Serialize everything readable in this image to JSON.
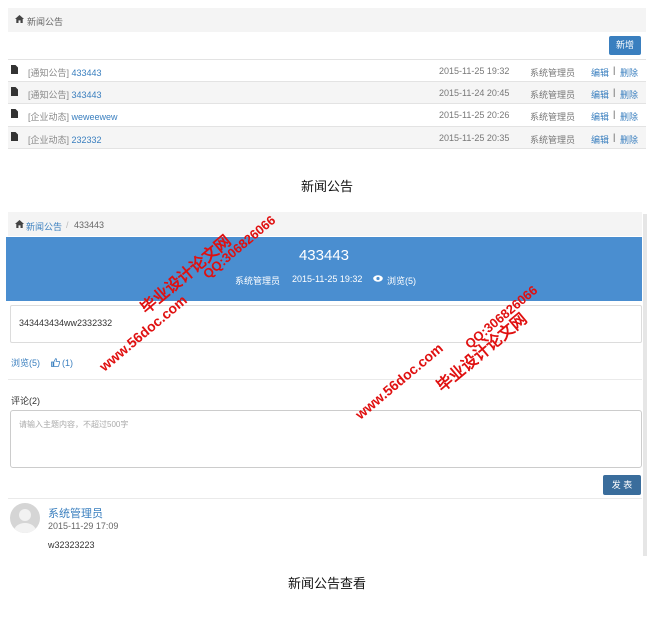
{
  "list_page": {
    "breadcrumb": "新闻公告",
    "add_button": "新增",
    "rows": [
      {
        "category": "[通知公告]",
        "title": "433443",
        "date": "2015-11-25 19:32",
        "author": "系统管理员",
        "edit": "编辑",
        "sep": "|",
        "delete": "删除"
      },
      {
        "category": "[通知公告]",
        "title": "343443",
        "date": "2015-11-24 20:45",
        "author": "系统管理员",
        "edit": "编辑",
        "sep": "|",
        "delete": "删除"
      },
      {
        "category": "[企业动态]",
        "title": "weweewew",
        "date": "2015-11-25 20:26",
        "author": "系统管理员",
        "edit": "编辑",
        "sep": "|",
        "delete": "删除"
      },
      {
        "category": "[企业动态]",
        "title": "232332",
        "date": "2015-11-25 20:35",
        "author": "系统管理员",
        "edit": "编辑",
        "sep": "|",
        "delete": "删除"
      }
    ],
    "caption": "新闻公告"
  },
  "view_page": {
    "breadcrumb_link": "新闻公告",
    "breadcrumb_sep": "/",
    "breadcrumb_current": "433443",
    "title": "433443",
    "author": "系统管理员",
    "date": "2015-11-25 19:32",
    "views": "浏览(5)",
    "content": "343443434ww2332332",
    "stats_views": "浏览(5)",
    "stats_likes": "(1)",
    "comments_label": "评论(2)",
    "comment_placeholder": "请输入主题内容，不超过500字",
    "post_button": "发 表",
    "comment": {
      "user": "系统管理员",
      "time": "2015-11-29 17:09",
      "text": "w32323223"
    },
    "caption": "新闻公告查看"
  },
  "watermarks": {
    "brand": "毕业设计论文网",
    "url": "www.56doc.com",
    "qq": "QQ:306826066"
  },
  "colors": {
    "accent": "#3a7fbf",
    "banner": "#4a8ed0",
    "watermark": "#e01010"
  }
}
